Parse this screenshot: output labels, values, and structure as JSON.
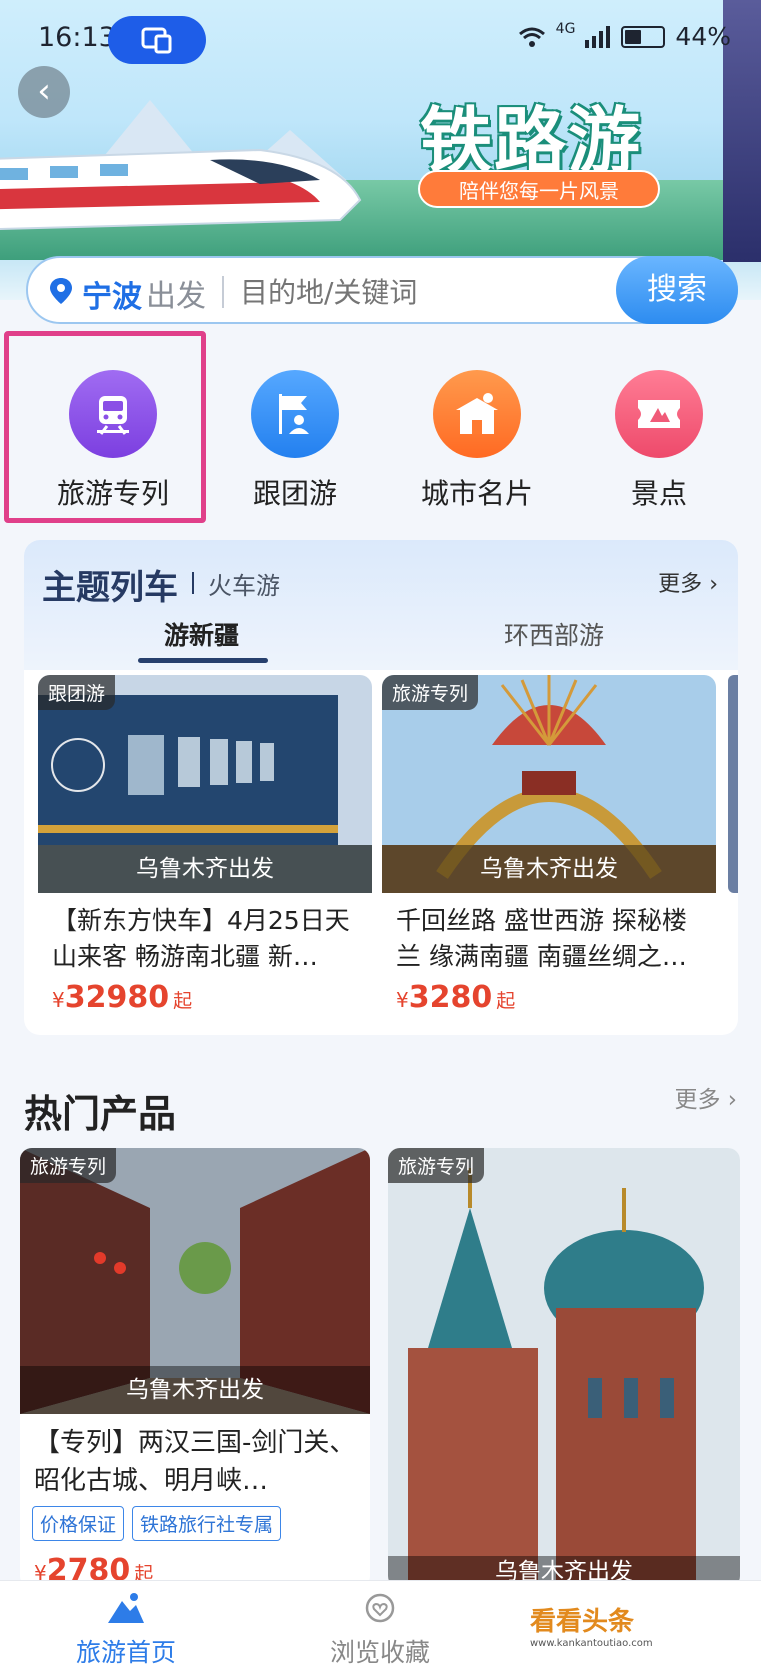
{
  "status_bar": {
    "time": "16:13",
    "battery": "44%",
    "network": "4G"
  },
  "banner": {
    "title": "铁路游",
    "subtitle": "陪伴您每一片风景"
  },
  "search": {
    "city": "宁波",
    "depart_label": "出发",
    "placeholder": "目的地/关键词",
    "button": "搜索"
  },
  "categories": [
    {
      "label": "旅游专列",
      "icon": "train-icon",
      "color": "#8a4fe6"
    },
    {
      "label": "跟团游",
      "icon": "flag-person-icon",
      "color": "#2f8cf0"
    },
    {
      "label": "城市名片",
      "icon": "city-gate-icon",
      "color": "#ff7a30"
    },
    {
      "label": "景点",
      "icon": "ticket-icon",
      "color": "#f05a78"
    }
  ],
  "theme_trains": {
    "title": "主题列车",
    "subtitle": "火车游",
    "more": "更多",
    "tabs": [
      "游新疆",
      "环西部游"
    ],
    "active_tab": 0,
    "products": [
      {
        "tag": "跟团游",
        "departure": "乌鲁木齐出发",
        "title": "【新东方快车】4月25日天山来客 畅游南北疆 新…",
        "currency": "¥",
        "price": "32980",
        "suffix": "起"
      },
      {
        "tag": "旅游专列",
        "departure": "乌鲁木齐出发",
        "title": "千回丝路 盛世西游 探秘楼兰 缘满南疆 南疆丝绸之…",
        "currency": "¥",
        "price": "3280",
        "suffix": "起"
      }
    ]
  },
  "hot_products": {
    "title": "热门产品",
    "more": "更多",
    "items": [
      {
        "tag": "旅游专列",
        "departure": "乌鲁木齐出发",
        "title": "【专列】两汉三国-剑门关、昭化古城、明月峡…",
        "chips": [
          "价格保证",
          "铁路旅行社专属"
        ],
        "currency": "¥",
        "price": "2780",
        "suffix": "起"
      },
      {
        "tag": "旅游专列",
        "departure": "乌鲁木齐出发"
      }
    ]
  },
  "bottom_nav": {
    "items": [
      "旅游首页",
      "浏览收藏"
    ],
    "active": 0,
    "watermark": "看看头条",
    "watermark_url": "www.kankantoutiao.com"
  },
  "colors": {
    "accent": "#2d7ce8",
    "price": "#e5442e",
    "highlight_box": "#e0408a"
  }
}
